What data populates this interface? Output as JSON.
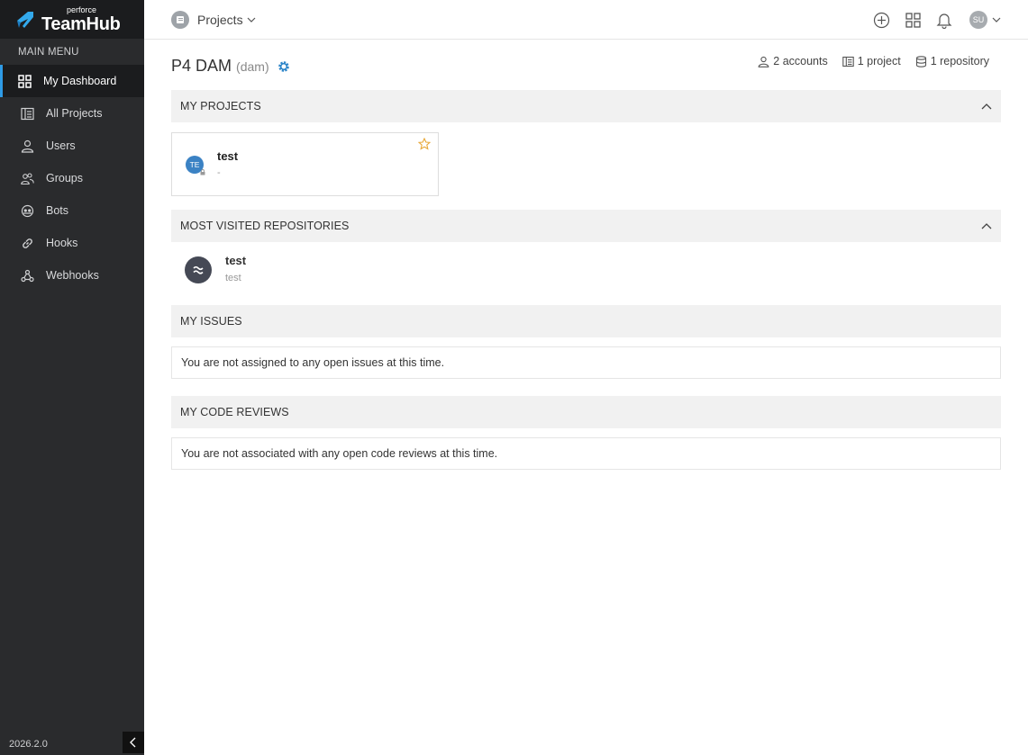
{
  "brand": {
    "small": "perforce",
    "name": "TeamHub"
  },
  "sidebar": {
    "menu_title": "MAIN MENU",
    "items": [
      {
        "label": "My Dashboard",
        "icon": "dashboard-icon",
        "active": true
      },
      {
        "label": "All Projects",
        "icon": "projects-icon"
      },
      {
        "label": "Users",
        "icon": "user-icon"
      },
      {
        "label": "Groups",
        "icon": "groups-icon"
      },
      {
        "label": "Bots",
        "icon": "bot-icon"
      },
      {
        "label": "Hooks",
        "icon": "link-icon"
      },
      {
        "label": "Webhooks",
        "icon": "webhook-icon"
      }
    ],
    "version": "2026.2.0"
  },
  "header": {
    "projects_label": "Projects",
    "avatar_initials": "SU"
  },
  "page": {
    "title": "P4 DAM",
    "subtitle": "(dam)",
    "stats": {
      "accounts": "2 accounts",
      "projects": "1 project",
      "repositories": "1 repository"
    }
  },
  "sections": {
    "my_projects": {
      "title": "MY PROJECTS",
      "project": {
        "initials": "TE",
        "name": "test",
        "description": "-"
      }
    },
    "repositories": {
      "title": "MOST VISITED REPOSITORIES",
      "repo": {
        "name": "test",
        "path": "test"
      }
    },
    "issues": {
      "title": "MY ISSUES",
      "empty": "You are not assigned to any open issues at this time."
    },
    "reviews": {
      "title": "MY CODE REVIEWS",
      "empty": "You are not associated with any open code reviews at this time."
    }
  },
  "colors": {
    "sidebar_bg": "#2a2b2d",
    "accent": "#2e9be6",
    "project_avatar": "#3b82c4",
    "star": "#e8a838"
  }
}
